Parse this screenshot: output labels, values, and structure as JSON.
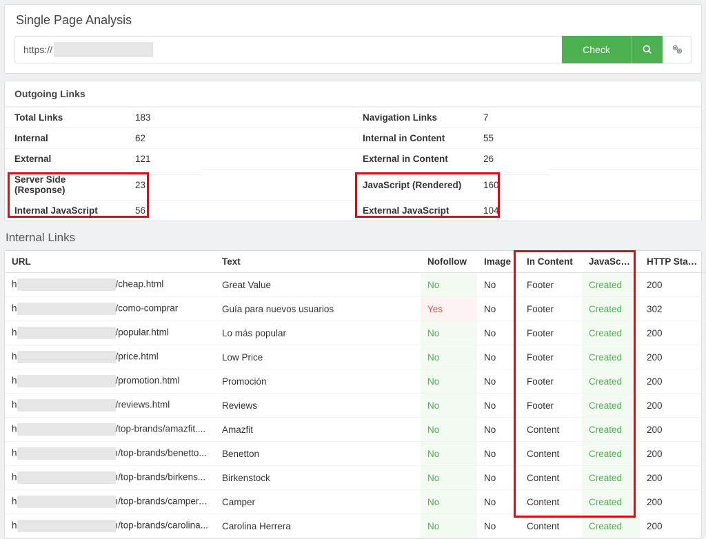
{
  "header": {
    "title": "Single Page Analysis",
    "url_prefix": "https://",
    "check_label": "Check"
  },
  "outgoing": {
    "title": "Outgoing Links",
    "left": [
      {
        "label": "Total Links",
        "value": "183"
      },
      {
        "label": "Internal",
        "value": "62"
      },
      {
        "label": "External",
        "value": "121"
      },
      {
        "label": "Server Side (Response)",
        "value": "23"
      },
      {
        "label": "Internal JavaScript",
        "value": "56"
      }
    ],
    "right": [
      {
        "label": "Navigation Links",
        "value": "7"
      },
      {
        "label": "Internal in Content",
        "value": "55"
      },
      {
        "label": "External in Content",
        "value": "26"
      },
      {
        "label": "JavaScript (Rendered)",
        "value": "160"
      },
      {
        "label": "External JavaScript",
        "value": "104"
      }
    ]
  },
  "internal_links": {
    "title": "Internal Links",
    "columns": [
      "URL",
      "Text",
      "Nofollow",
      "Image",
      "In Content",
      "JavaScript",
      "HTTP Status"
    ],
    "rows": [
      {
        "pre": "h",
        "suf": "/cheap.html",
        "text": "Great Value",
        "nf": "No",
        "nf_kind": "green",
        "img": "No",
        "inc": "Footer",
        "js": "Created",
        "http": "200"
      },
      {
        "pre": "h",
        "suf": "/como-comprar",
        "text": "Guía para nuevos usuarios",
        "nf": "Yes",
        "nf_kind": "red",
        "img": "No",
        "inc": "Footer",
        "js": "Created",
        "http": "302"
      },
      {
        "pre": "h",
        "suf": "/popular.html",
        "text": "Lo más popular",
        "nf": "No",
        "nf_kind": "green",
        "img": "No",
        "inc": "Footer",
        "js": "Created",
        "http": "200"
      },
      {
        "pre": "h",
        "suf": "/price.html",
        "text": "Low Price",
        "nf": "No",
        "nf_kind": "green",
        "img": "No",
        "inc": "Footer",
        "js": "Created",
        "http": "200"
      },
      {
        "pre": "h",
        "suf": "/promotion.html",
        "text": "Promoción",
        "nf": "No",
        "nf_kind": "green",
        "img": "No",
        "inc": "Footer",
        "js": "Created",
        "http": "200"
      },
      {
        "pre": "h",
        "suf": "/reviews.html",
        "text": "Reviews",
        "nf": "No",
        "nf_kind": "green",
        "img": "No",
        "inc": "Footer",
        "js": "Created",
        "http": "200"
      },
      {
        "pre": "h",
        "suf": "/top-brands/amazfit....",
        "text": "Amazfit",
        "nf": "No",
        "nf_kind": "green",
        "img": "No",
        "inc": "Content",
        "js": "Created",
        "http": "200"
      },
      {
        "pre": "h",
        "suf": "ı/top-brands/benetto...",
        "text": "Benetton",
        "nf": "No",
        "nf_kind": "green",
        "img": "No",
        "inc": "Content",
        "js": "Created",
        "http": "200"
      },
      {
        "pre": "h",
        "suf": "ı/top-brands/birkens...",
        "text": "Birkenstock",
        "nf": "No",
        "nf_kind": "green",
        "img": "No",
        "inc": "Content",
        "js": "Created",
        "http": "200"
      },
      {
        "pre": "h",
        "suf": "ı/top-brands/camper....",
        "text": "Camper",
        "nf": "No",
        "nf_kind": "green",
        "img": "No",
        "inc": "Content",
        "js": "Created",
        "http": "200"
      },
      {
        "pre": "h",
        "suf": "ı/top-brands/carolina...",
        "text": "Carolina Herrera",
        "nf": "No",
        "nf_kind": "green",
        "img": "No",
        "inc": "Content",
        "js": "Created",
        "http": "200"
      }
    ]
  }
}
